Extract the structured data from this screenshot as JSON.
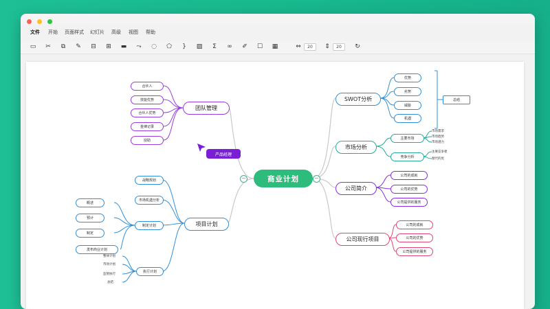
{
  "menu": [
    "文件",
    "开始",
    "页面样式",
    "幻灯片",
    "高级",
    "视图",
    "帮助"
  ],
  "toolbar": {
    "icons": [
      "new-document-icon",
      "cut-icon",
      "copy-icon",
      "format-painter-icon",
      "insert-sibling-icon",
      "insert-child-icon",
      "topic-icon",
      "relationship-icon",
      "note-bubble-icon",
      "label-icon",
      "summary-icon",
      "image-icon",
      "formula-icon",
      "link-icon",
      "pen-icon",
      "comment-icon",
      "calendar-icon"
    ],
    "spacing_h": "20",
    "spacing_v": "20"
  },
  "colors": {
    "green": "#2ebc7d",
    "blue": "#2f8fd8",
    "purple": "#8a2be2",
    "pink": "#e0456f",
    "teal": "#1ebf95"
  },
  "mindmap": {
    "central": "商业计划",
    "branches": {
      "team": {
        "label": "团队管理",
        "children": [
          "合伙人",
          "技能优势",
          "合伙人优势",
          "金律记录",
          "授助"
        ]
      },
      "swot": {
        "label": "SWOT分析",
        "children": [
          "优势",
          "劣势",
          "威胁",
          "机遇"
        ],
        "summary": "总结"
      },
      "market": {
        "label": "市场分析",
        "children": [
          {
            "label": "主要市场",
            "items": [
              "市场需求",
              "市场趋势",
              "市场潜力"
            ]
          },
          {
            "label": "竞争分析",
            "items": [
              "主要竞争者",
              "替代的优"
            ]
          }
        ]
      },
      "intro": {
        "label": "公司简介",
        "children": [
          "公司的成就",
          "公司的优势",
          "公司提供的服务"
        ]
      },
      "current": {
        "label": "公司现行项目",
        "children": [
          "公司的成就",
          "公司的优势",
          "公司提供的服务"
        ]
      },
      "project": {
        "label": "项目计划",
        "children": [
          "战略规划",
          "市场机遇分析",
          "制定计划",
          "执行计划"
        ],
        "plan_items": [
          "概述",
          "预计",
          "制定",
          "发布商业计划"
        ],
        "exec_items": [
          "整体计划",
          "市场计划",
          "监管执行",
          "总结"
        ]
      }
    },
    "float_label": "产品经理"
  }
}
